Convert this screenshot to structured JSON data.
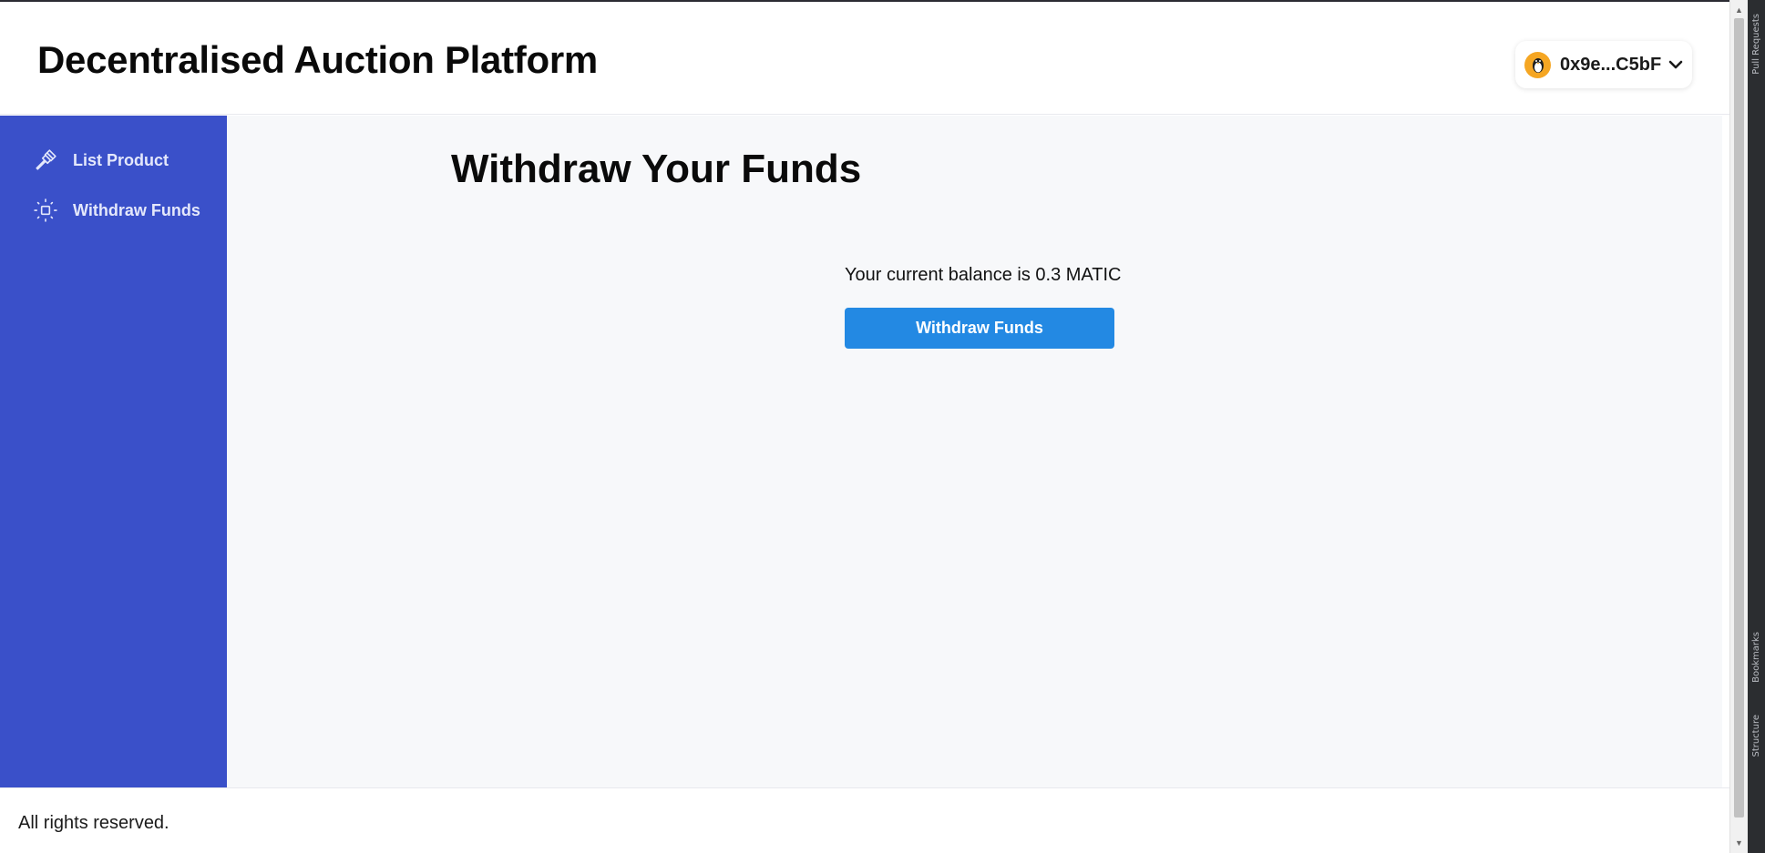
{
  "header": {
    "title": "Decentralised Auction Platform",
    "wallet": {
      "address": "0x9e...C5bF",
      "avatar_icon": "penguin-avatar-icon",
      "dropdown_icon": "chevron-down-icon"
    }
  },
  "sidebar": {
    "items": [
      {
        "label": "List Product",
        "icon": "gavel-icon"
      },
      {
        "label": "Withdraw Funds",
        "icon": "focus-square-icon"
      }
    ]
  },
  "main": {
    "heading": "Withdraw Your Funds",
    "balance_text": "Your current balance is 0.3 MATIC",
    "withdraw_button": "Withdraw Funds"
  },
  "footer": {
    "text": "All rights reserved."
  },
  "ide_strip": {
    "tabs": [
      "Pull Requests",
      "Bookmarks",
      "Structure"
    ]
  },
  "colors": {
    "sidebar": "#3a50c9",
    "main_background": "#f7f8fa",
    "button": "#2389e3",
    "avatar": "#f5a623"
  }
}
